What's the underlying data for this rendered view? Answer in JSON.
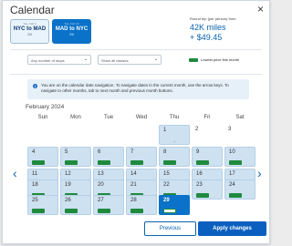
{
  "dialog": {
    "title": "Calendar",
    "close_symbol": "×"
  },
  "tabs": [
    {
      "label": "Tue, Feb 6",
      "route": "NYC to MAD",
      "date": "2/6",
      "active": false
    },
    {
      "label": "Tue, Feb 13",
      "route": "MAD to NYC",
      "date": "2/6",
      "active": true
    }
  ],
  "price": {
    "label": "Round trip (per person) from",
    "miles": "42K miles",
    "cash": "+ $49.45"
  },
  "filters": {
    "stops": "Any number of stops",
    "classes": "Show all classes"
  },
  "legend": {
    "label": "Lowest price this month",
    "color": "#1f8a3d"
  },
  "info": {
    "icon": "info-icon",
    "text": "You are on the calendar date navigation. To navigate dates in the current month, use the arrow keys. To navigate to other months, tab to next month and previous month buttons."
  },
  "calendar": {
    "month": "February 2024",
    "days": [
      "Sun",
      "Mon",
      "Tue",
      "Wed",
      "Thu",
      "Fri",
      "Sat"
    ],
    "cells": {
      "feb1": {
        "day": "1",
        "note": "--"
      },
      "feb2": {
        "day": "2"
      },
      "feb3": {
        "day": "3"
      },
      "feb4": {
        "day": "4"
      },
      "feb5": {
        "day": "5"
      },
      "feb6": {
        "day": "6"
      },
      "feb7": {
        "day": "7"
      },
      "feb8": {
        "day": "8"
      },
      "feb9": {
        "day": "9"
      },
      "feb10": {
        "day": "10"
      },
      "feb11": {
        "day": "11"
      },
      "feb12": {
        "day": "12"
      },
      "feb13": {
        "day": "13"
      },
      "feb14": {
        "day": "14"
      },
      "feb15": {
        "day": "15"
      },
      "feb16": {
        "day": "16"
      },
      "feb17": {
        "day": "17"
      },
      "feb18": {
        "day": "18"
      },
      "feb19": {
        "day": "19"
      },
      "feb20": {
        "day": "20"
      },
      "feb21": {
        "day": "21"
      },
      "feb22": {
        "day": "22"
      },
      "feb23": {
        "day": "23"
      },
      "feb24": {
        "day": "24"
      },
      "feb25": {
        "day": "25"
      },
      "feb26": {
        "day": "26"
      },
      "feb27": {
        "day": "27"
      },
      "feb28": {
        "day": "28"
      },
      "feb29": {
        "day": "29",
        "selected": true
      }
    },
    "prev_symbol": "‹",
    "next_symbol": "›"
  },
  "buttons": {
    "previous": "Previous",
    "apply": "Apply changes"
  }
}
